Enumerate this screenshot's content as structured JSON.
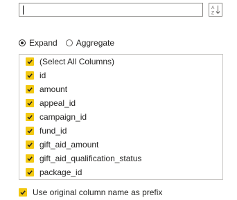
{
  "search": {
    "value": "",
    "placeholder": ""
  },
  "sort_icon": "sort-ascending-icon",
  "mode": {
    "options": [
      {
        "label": "Expand",
        "selected": true
      },
      {
        "label": "Aggregate",
        "selected": false
      }
    ]
  },
  "columns": [
    {
      "label": "(Select All Columns)",
      "checked": true
    },
    {
      "label": "id",
      "checked": true
    },
    {
      "label": "amount",
      "checked": true
    },
    {
      "label": "appeal_id",
      "checked": true
    },
    {
      "label": "campaign_id",
      "checked": true
    },
    {
      "label": "fund_id",
      "checked": true
    },
    {
      "label": "gift_aid_amount",
      "checked": true
    },
    {
      "label": "gift_aid_qualification_status",
      "checked": true
    },
    {
      "label": "package_id",
      "checked": true
    }
  ],
  "prefix_option": {
    "label": "Use original column name as prefix",
    "checked": true
  },
  "colors": {
    "accent": "#f2c811",
    "text": "#252423",
    "border": "#8a8886"
  }
}
